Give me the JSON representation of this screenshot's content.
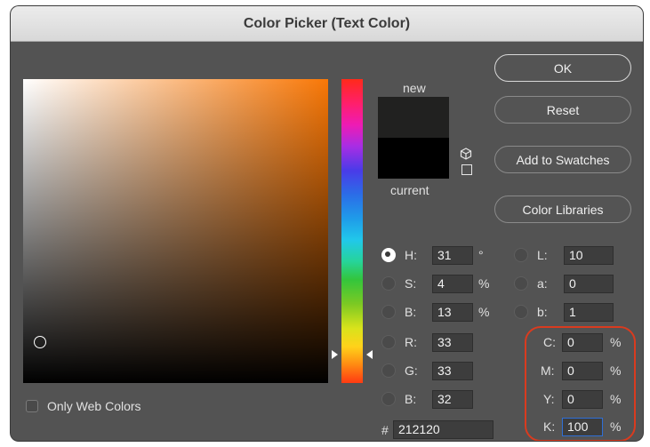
{
  "window": {
    "title": "Color Picker (Text Color)"
  },
  "preview": {
    "new_label": "new",
    "current_label": "current"
  },
  "buttons": {
    "ok": "OK",
    "reset": "Reset",
    "add_to_swatches": "Add to Swatches",
    "color_libraries": "Color Libraries"
  },
  "hsb": {
    "h": {
      "label": "H:",
      "value": "31",
      "unit": "°"
    },
    "s": {
      "label": "S:",
      "value": "4",
      "unit": "%"
    },
    "b": {
      "label": "B:",
      "value": "13",
      "unit": "%"
    }
  },
  "rgb": {
    "r": {
      "label": "R:",
      "value": "33"
    },
    "g": {
      "label": "G:",
      "value": "33"
    },
    "b": {
      "label": "B:",
      "value": "32"
    }
  },
  "lab": {
    "l": {
      "label": "L:",
      "value": "10"
    },
    "a": {
      "label": "a:",
      "value": "0"
    },
    "b": {
      "label": "b:",
      "value": "1"
    }
  },
  "cmyk": {
    "c": {
      "label": "C:",
      "value": "0",
      "unit": "%"
    },
    "m": {
      "label": "M:",
      "value": "0",
      "unit": "%"
    },
    "y": {
      "label": "Y:",
      "value": "0",
      "unit": "%"
    },
    "k": {
      "label": "K:",
      "value": "100",
      "unit": "%"
    }
  },
  "hex": {
    "label": "#",
    "value": "212120"
  },
  "only_web_colors": {
    "label": "Only Web Colors",
    "checked": false
  },
  "colors": {
    "new": "#212120",
    "current": "#000000",
    "dialog_bg": "#535353",
    "highlight": "#d93b1f"
  }
}
